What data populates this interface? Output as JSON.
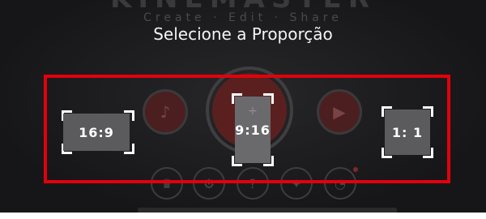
{
  "background": {
    "logo_text": "KINEMASTER",
    "tagline": "Create · Edit · Share",
    "icons": [
      "tiktok-icon",
      "youtube-icon",
      "plus-icon",
      "crown-icon",
      "settings-icon",
      "help-icon",
      "magic-icon",
      "notification-icon"
    ]
  },
  "dialog": {
    "title": "Selecione a Proporção",
    "options": [
      {
        "label": "16:9"
      },
      {
        "label": "9:16"
      },
      {
        "label": "1: 1"
      }
    ]
  },
  "colors": {
    "highlight": "#e3000b",
    "tile": "#5b5b5e",
    "background": "#1c1c1e"
  }
}
